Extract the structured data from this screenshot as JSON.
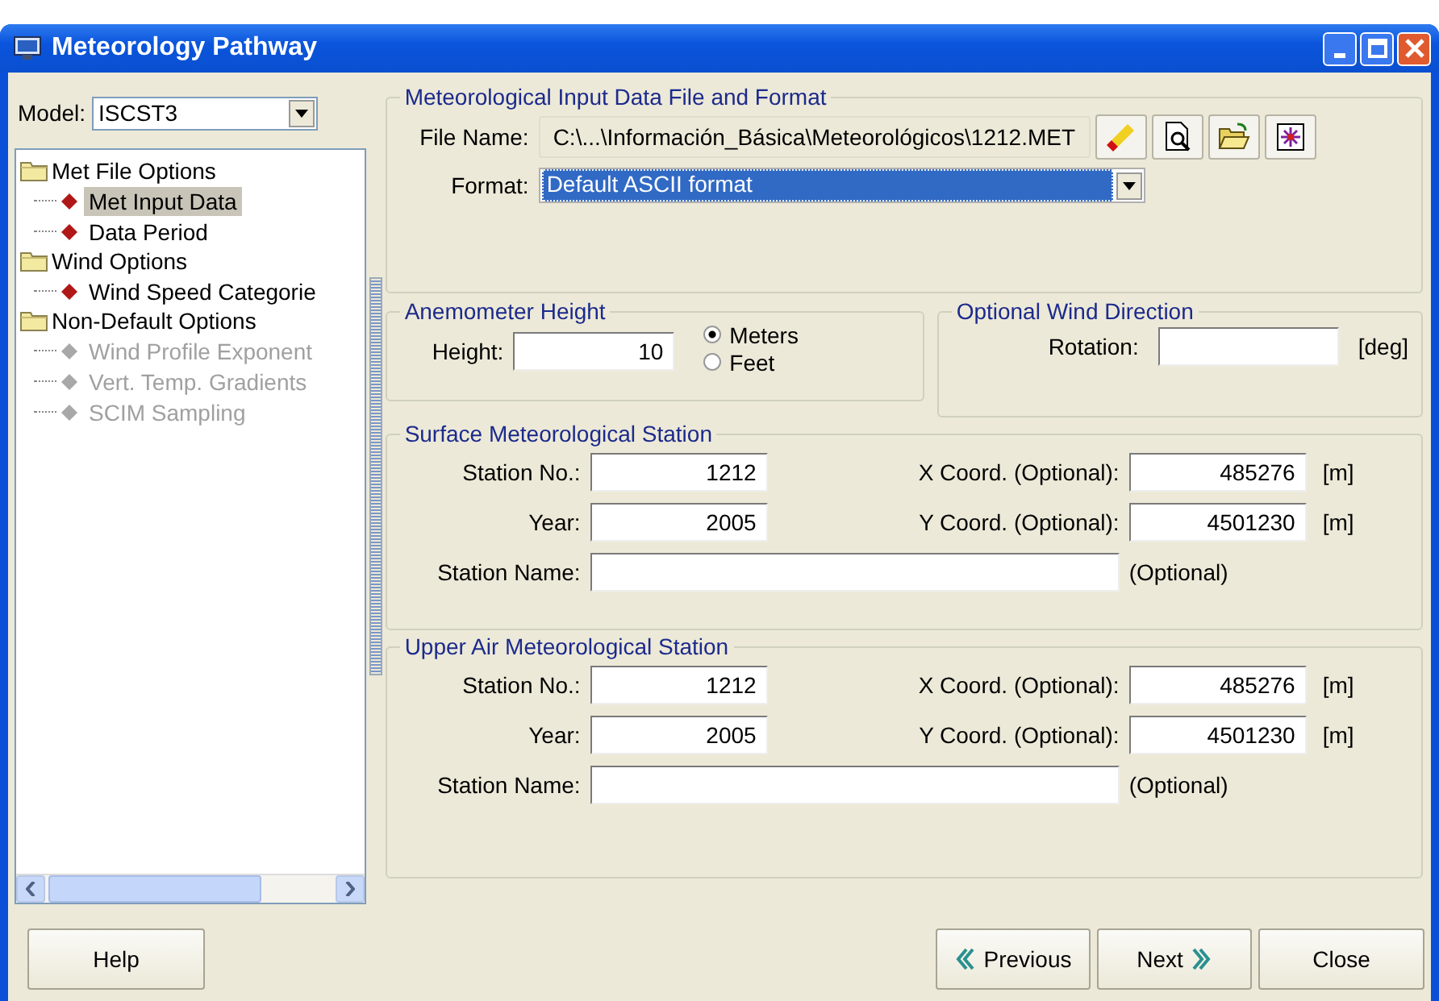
{
  "window": {
    "title": "Meteorology Pathway"
  },
  "model": {
    "label": "Model:",
    "value": "ISCST3"
  },
  "tree": [
    {
      "label": "Met File Options",
      "children": [
        {
          "label": "Met Input Data",
          "selected": true,
          "disabled": false
        },
        {
          "label": "Data Period",
          "selected": false,
          "disabled": false
        }
      ]
    },
    {
      "label": "Wind Options",
      "children": [
        {
          "label": "Wind Speed Categorie",
          "selected": false,
          "disabled": false
        }
      ]
    },
    {
      "label": "Non-Default Options",
      "children": [
        {
          "label": "Wind Profile Exponent",
          "selected": false,
          "disabled": true
        },
        {
          "label": "Vert. Temp. Gradients",
          "selected": false,
          "disabled": true
        },
        {
          "label": "SCIM Sampling",
          "selected": false,
          "disabled": true
        }
      ]
    }
  ],
  "file_section": {
    "title": "Meteorological Input Data File and Format",
    "file_label": "File Name:",
    "file_value": "C:\\...\\Información_Básica\\Meteorológicos\\1212.MET",
    "format_label": "Format:",
    "format_value": "Default ASCII format"
  },
  "anemometer": {
    "title": "Anemometer Height",
    "height_label": "Height:",
    "height_value": "10",
    "units": [
      {
        "label": "Meters",
        "selected": true
      },
      {
        "label": "Feet",
        "selected": false
      }
    ]
  },
  "wind_direction": {
    "title": "Optional Wind Direction",
    "rotation_label": "Rotation:",
    "unit": "[deg]"
  },
  "stations": [
    {
      "title": "Surface Meteorological Station",
      "station_no": {
        "label": "Station No.:",
        "value": "1212"
      },
      "year": {
        "label": "Year:",
        "value": "2005"
      },
      "x_coord": {
        "label": "X Coord. (Optional):",
        "value": "485276",
        "unit": "[m]"
      },
      "y_coord": {
        "label": "Y Coord. (Optional):",
        "value": "4501230",
        "unit": "[m]"
      },
      "station_name": {
        "label": "Station Name:",
        "note": "(Optional)"
      }
    },
    {
      "title": "Upper Air Meteorological Station",
      "station_no": {
        "label": "Station No.:",
        "value": "1212"
      },
      "year": {
        "label": "Year:",
        "value": "2005"
      },
      "x_coord": {
        "label": "X Coord. (Optional):",
        "value": "485276",
        "unit": "[m]"
      },
      "y_coord": {
        "label": "Y Coord. (Optional):",
        "value": "4501230",
        "unit": "[m]"
      },
      "station_name": {
        "label": "Station Name:",
        "note": "(Optional)"
      }
    }
  ],
  "help_button": "Help",
  "nav_buttons": [
    {
      "label": "Previous",
      "kind": "previous"
    },
    {
      "label": "Next",
      "kind": "next"
    },
    {
      "label": "Close",
      "kind": "close"
    }
  ]
}
